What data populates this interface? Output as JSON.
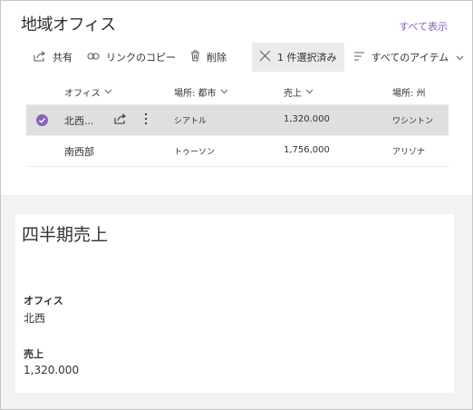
{
  "list": {
    "title": "地域オフィス",
    "see_all": "すべて表示"
  },
  "commands": {
    "share": "共有",
    "copy_link": "リンクのコピー",
    "delete": "削除",
    "selected": "1 件選択済み",
    "view": "すべてのアイテム"
  },
  "columns": {
    "office": "オフィス",
    "city": "場所: 都市",
    "sales": "売上",
    "state": "場所: 州"
  },
  "rows": [
    {
      "office": "北西...",
      "city": "シアトル",
      "sales": "1,320.000",
      "state": "ワシントン",
      "selected": true
    },
    {
      "office": "南西部",
      "city": "トゥーソン",
      "sales": "1,756,000",
      "state": "アリゾナ",
      "selected": false
    }
  ],
  "detail": {
    "title": "四半期売上",
    "office_label": "オフィス",
    "office_value": "北西",
    "sales_label": "売上",
    "sales_value": "1,320.000"
  },
  "colors": {
    "accent": "#8764b8",
    "selected_row": "#e1dfdd"
  },
  "icons": [
    "share-icon",
    "link-icon",
    "trash-icon",
    "close-icon",
    "list-view-icon",
    "chevron-down-icon",
    "checkmark-icon",
    "more-icon"
  ]
}
